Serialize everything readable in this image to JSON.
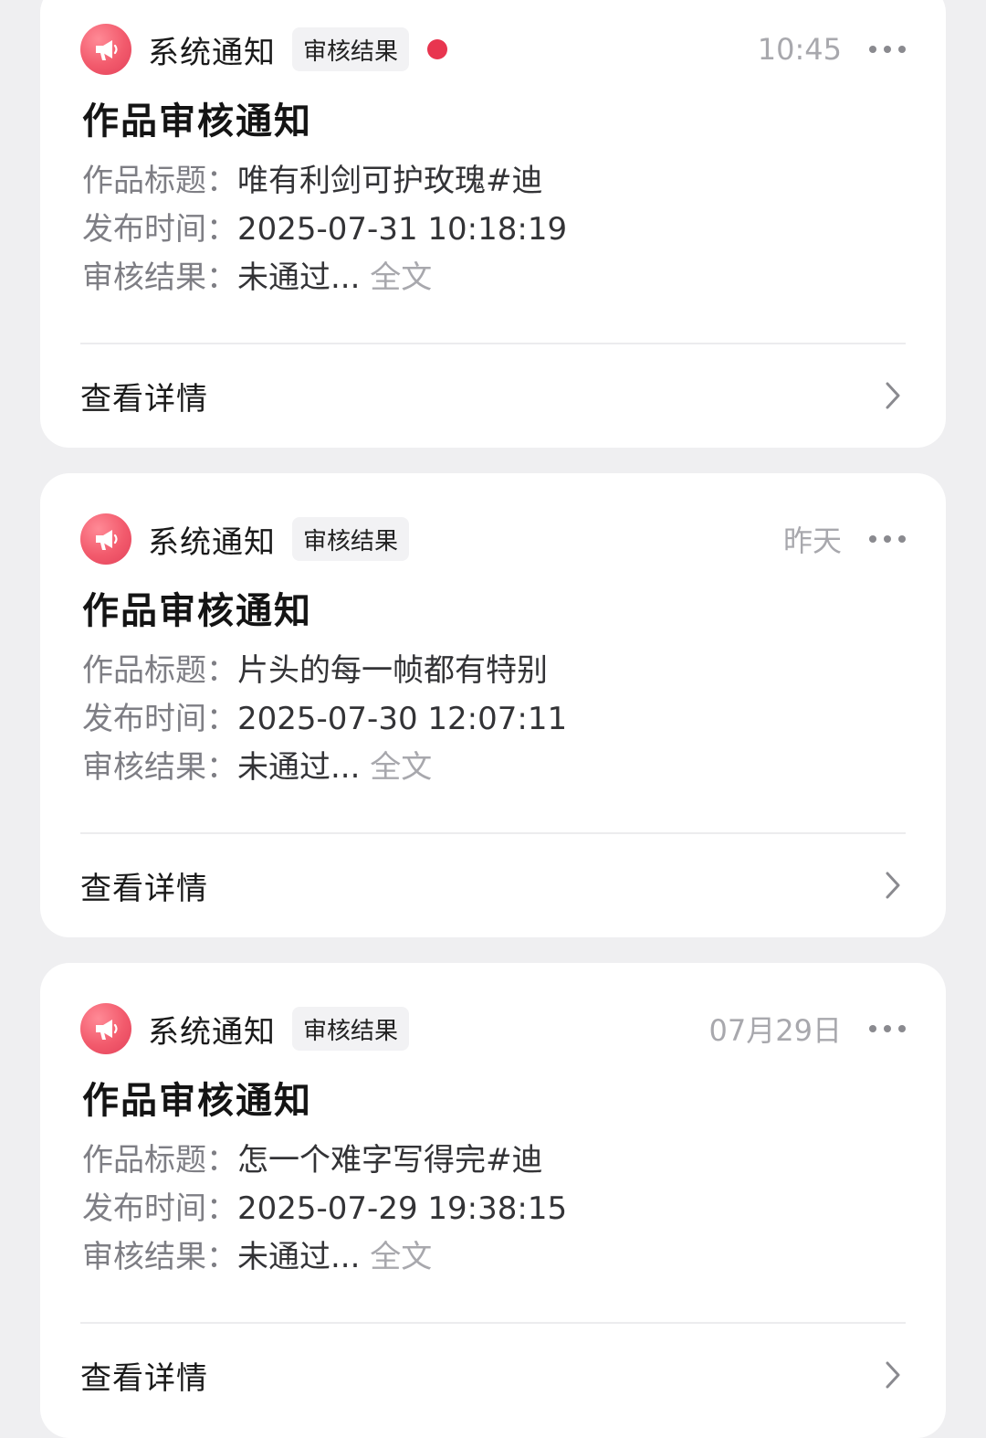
{
  "notifications": [
    {
      "sender": "系统通知",
      "tag": "审核结果",
      "unread": true,
      "time": "10:45",
      "title": "作品审核通知",
      "fields": [
        {
          "label": "作品标题：",
          "value": "唯有利剑可护玫瑰#迪"
        },
        {
          "label": "发布时间：",
          "value": "2025-07-31 10:18:19"
        },
        {
          "label": "审核结果：",
          "value": "未通过... ",
          "more": "全文"
        }
      ],
      "detail_label": "查看详情"
    },
    {
      "sender": "系统通知",
      "tag": "审核结果",
      "unread": false,
      "time": "昨天",
      "title": "作品审核通知",
      "fields": [
        {
          "label": "作品标题：",
          "value": "片头的每一帧都有特别"
        },
        {
          "label": "发布时间：",
          "value": "2025-07-30 12:07:11"
        },
        {
          "label": "审核结果：",
          "value": "未通过... ",
          "more": "全文"
        }
      ],
      "detail_label": "查看详情"
    },
    {
      "sender": "系统通知",
      "tag": "审核结果",
      "unread": false,
      "time": "07月29日",
      "title": "作品审核通知",
      "fields": [
        {
          "label": "作品标题：",
          "value": "怎一个难字写得完#迪"
        },
        {
          "label": "发布时间：",
          "value": "2025-07-29 19:38:15"
        },
        {
          "label": "审核结果：",
          "value": "未通过... ",
          "more": "全文"
        }
      ],
      "detail_label": "查看详情"
    }
  ],
  "colors": {
    "accent_red": "#e8354f",
    "avatar_gradient": "#f25a6c",
    "background": "#efeff1"
  },
  "icons": {
    "avatar": "megaphone-icon",
    "more": "more-dots-icon",
    "chevron": "chevron-right-icon"
  }
}
